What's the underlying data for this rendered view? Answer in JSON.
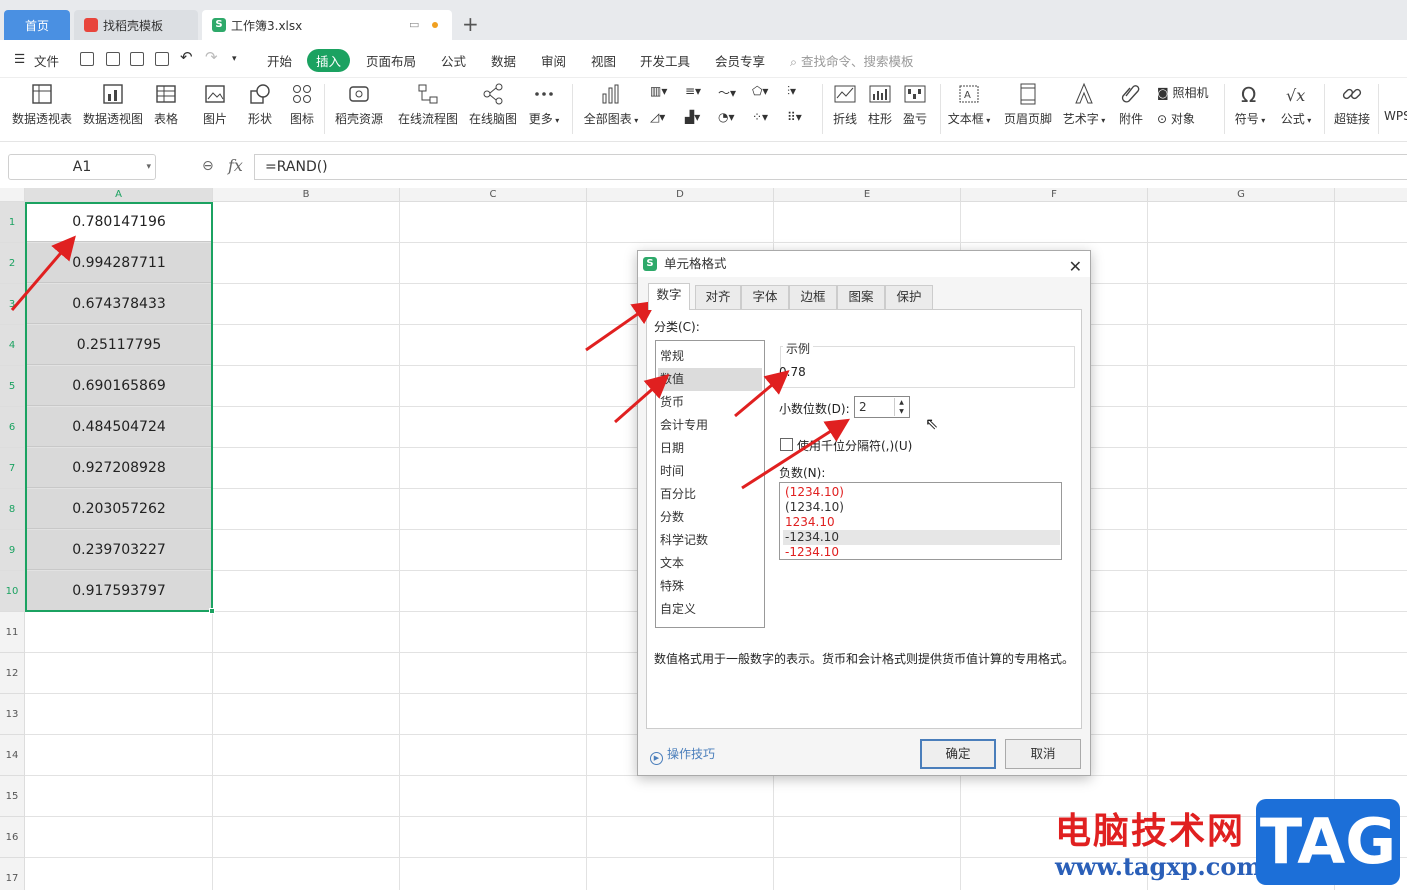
{
  "tabs": {
    "home": "首页",
    "template": "找稻壳模板",
    "doc": "工作簿3.xlsx"
  },
  "menu": {
    "file": "文件",
    "items": [
      "开始",
      "插入",
      "页面布局",
      "公式",
      "数据",
      "审阅",
      "视图",
      "开发工具",
      "会员专享"
    ],
    "active": "插入",
    "search": "查找命令、搜索模板"
  },
  "ribbon": {
    "buttons": [
      "数据透视表",
      "数据透视图",
      "表格",
      "图片",
      "形状",
      "图标",
      "稻壳资源",
      "在线流程图",
      "在线脑图",
      "更多",
      "全部图表",
      "折线",
      "柱形",
      "盈亏",
      "文本框",
      "页眉页脚",
      "艺术字",
      "附件",
      "照相机",
      "对象",
      "符号",
      "公式",
      "超链接",
      "WPS"
    ]
  },
  "formula_bar": {
    "cell_ref": "A1",
    "formula": "=RAND()"
  },
  "sheet": {
    "columns": [
      "A",
      "B",
      "C",
      "D",
      "E",
      "F",
      "G"
    ],
    "rows": [
      "1",
      "2",
      "3",
      "4",
      "5",
      "6",
      "7",
      "8",
      "9",
      "10",
      "11",
      "12",
      "13",
      "14",
      "15",
      "16",
      "17"
    ],
    "a_values": [
      "0.780147196",
      "0.994287711",
      "0.674378433",
      "0.25117795",
      "0.690165869",
      "0.484504724",
      "0.927208928",
      "0.203057262",
      "0.239703227",
      "0.917593797"
    ]
  },
  "dialog": {
    "title": "单元格格式",
    "tabs": [
      "数字",
      "对齐",
      "字体",
      "边框",
      "图案",
      "保护"
    ],
    "category_label": "分类(C):",
    "categories": [
      "常规",
      "数值",
      "货币",
      "会计专用",
      "日期",
      "时间",
      "百分比",
      "分数",
      "科学记数",
      "文本",
      "特殊",
      "自定义"
    ],
    "selected_category": "数值",
    "sample_label": "示例",
    "sample_value": "0.78",
    "decimal_label": "小数位数(D):",
    "decimal_value": "2",
    "thousands_label": "使用千位分隔符(,)(U)",
    "negative_label": "负数(N):",
    "negatives": [
      "(1234.10)",
      "(1234.10)",
      "1234.10",
      "-1234.10",
      "-1234.10"
    ],
    "description": "数值格式用于一般数字的表示。货币和会计格式则提供货币值计算的专用格式。",
    "tips": "操作技巧",
    "ok": "确定",
    "cancel": "取消"
  },
  "watermark": {
    "site": "电脑技术网",
    "url": "www.tagxp.com",
    "tag": "TAG"
  },
  "colors": {
    "accent_green": "#1ba261",
    "arrow_red": "#e02020",
    "tab_blue": "#4a90e2"
  }
}
